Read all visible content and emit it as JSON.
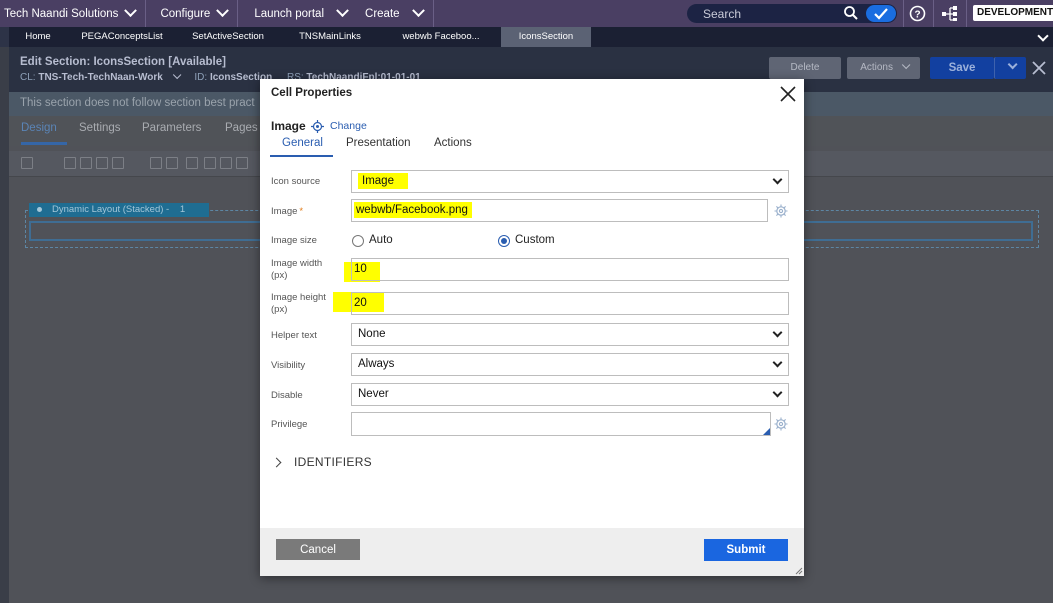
{
  "topbar": {
    "app_name": "Tech Naandi Solutions",
    "menus": [
      "Configure",
      "Launch portal",
      "Create"
    ],
    "search_placeholder": "Search",
    "env_badge": "DEVELOPMENT",
    "colors": {
      "bar": "#4a3f63",
      "search_go": "#1a6de0"
    }
  },
  "doc_tabs": [
    {
      "label": "Home",
      "active": false
    },
    {
      "label": "PEGAConceptsList",
      "active": false
    },
    {
      "label": "SetActiveSection",
      "active": false
    },
    {
      "label": "TNSMainLinks",
      "active": false
    },
    {
      "label": "webwb Faceboo...",
      "active": false
    },
    {
      "label": "IconsSection",
      "active": true
    }
  ],
  "workspace": {
    "title": "Edit  Section: IconsSection [Available]",
    "cl_label": "CL:",
    "cl_value": "TNS-Tech-TechNaan-Work",
    "id_label": "ID:",
    "id_value": "IconsSection",
    "rs_label": "RS:",
    "rs_value": "TechNaandiFpl:01-01-01",
    "buttons": {
      "delete": "Delete",
      "actions": "Actions",
      "save": "Save"
    },
    "notice": "This section does not follow section best pract",
    "tabs": [
      "Design",
      "Settings",
      "Parameters",
      "Pages"
    ],
    "layout_tag": "Dynamic Layout (Stacked) -",
    "layout_tag_count": "1"
  },
  "dialog": {
    "title": "Cell Properties",
    "control_type": "Image",
    "change_link": "Change",
    "tabs": [
      {
        "label": "General",
        "active": true
      },
      {
        "label": "Presentation",
        "active": false
      },
      {
        "label": "Actions",
        "active": false
      }
    ],
    "fields": {
      "icon_source": {
        "label": "Icon source",
        "value": "Image"
      },
      "image": {
        "label": "Image",
        "required_mark": "*",
        "value": "webwb/Facebook.png"
      },
      "image_size": {
        "label": "Image size",
        "options": [
          "Auto",
          "Custom"
        ],
        "selected": "Custom"
      },
      "image_width": {
        "label_line1": "Image width",
        "label_line2": "(px)",
        "value": "10"
      },
      "image_height": {
        "label_line1": "Image height",
        "label_line2": "(px)",
        "value": "20"
      },
      "helper_text": {
        "label": "Helper text",
        "value": "None"
      },
      "visibility": {
        "label": "Visibility",
        "value": "Always"
      },
      "disable": {
        "label": "Disable",
        "value": "Never"
      },
      "privilege": {
        "label": "Privilege",
        "value": ""
      }
    },
    "identifiers_label": "IDENTIFIERS",
    "footer": {
      "cancel": "Cancel",
      "submit": "Submit"
    },
    "colors": {
      "highlight": "#ffff00",
      "link": "#2a5db0",
      "submit": "#1a66e0",
      "cancel": "#7a7a7a"
    }
  }
}
